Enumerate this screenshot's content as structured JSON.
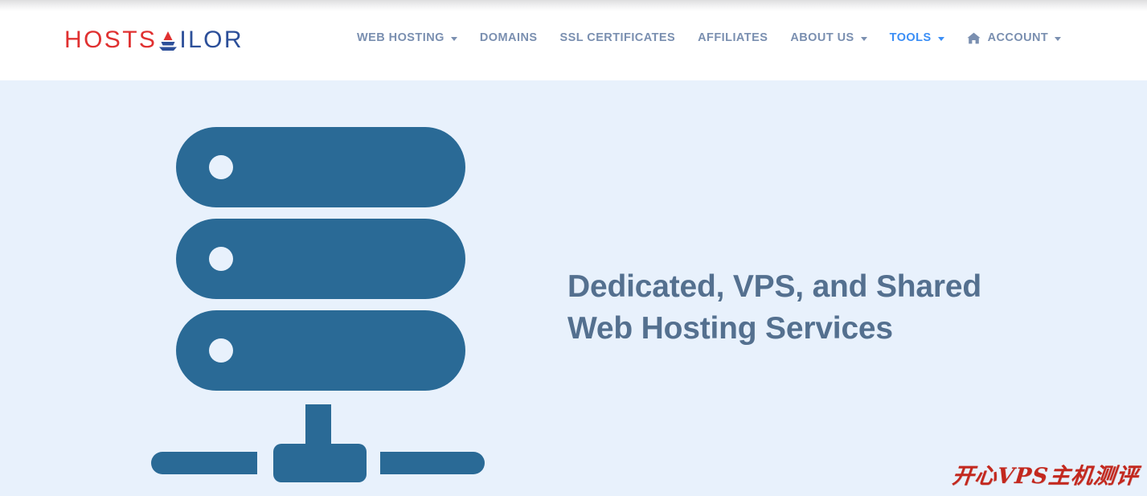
{
  "brand": {
    "logo_part1": "HOSTS",
    "logo_icon": "sailboat-icon",
    "logo_part2": "ILOR",
    "color_red": "#e03131",
    "color_blue": "#2c4f99"
  },
  "nav": {
    "items": [
      {
        "label": "WEB HOSTING",
        "has_caret": true,
        "active": false,
        "icon": null
      },
      {
        "label": "DOMAINS",
        "has_caret": false,
        "active": false,
        "icon": null
      },
      {
        "label": "SSL CERTIFICATES",
        "has_caret": false,
        "active": false,
        "icon": null
      },
      {
        "label": "AFFILIATES",
        "has_caret": false,
        "active": false,
        "icon": null
      },
      {
        "label": "ABOUT US",
        "has_caret": true,
        "active": false,
        "icon": null
      },
      {
        "label": "TOOLS",
        "has_caret": true,
        "active": true,
        "icon": null
      },
      {
        "label": "ACCOUNT",
        "has_caret": true,
        "active": false,
        "icon": "home-icon"
      }
    ],
    "text_color": "#7a8fb0",
    "active_color": "#3a8ef6"
  },
  "hero": {
    "background_color": "#e8f1fc",
    "heading_line1": "Dedicated, VPS, and Shared",
    "heading_line2": "Web Hosting Services",
    "heading_color": "#54708f",
    "illustration": {
      "name": "server-rack-illustration",
      "color": "#2a6a96",
      "bar_count": 3,
      "indicator_count": 3
    }
  },
  "watermark": {
    "text": "开心VPS主机测评",
    "color": "#c3281e"
  }
}
